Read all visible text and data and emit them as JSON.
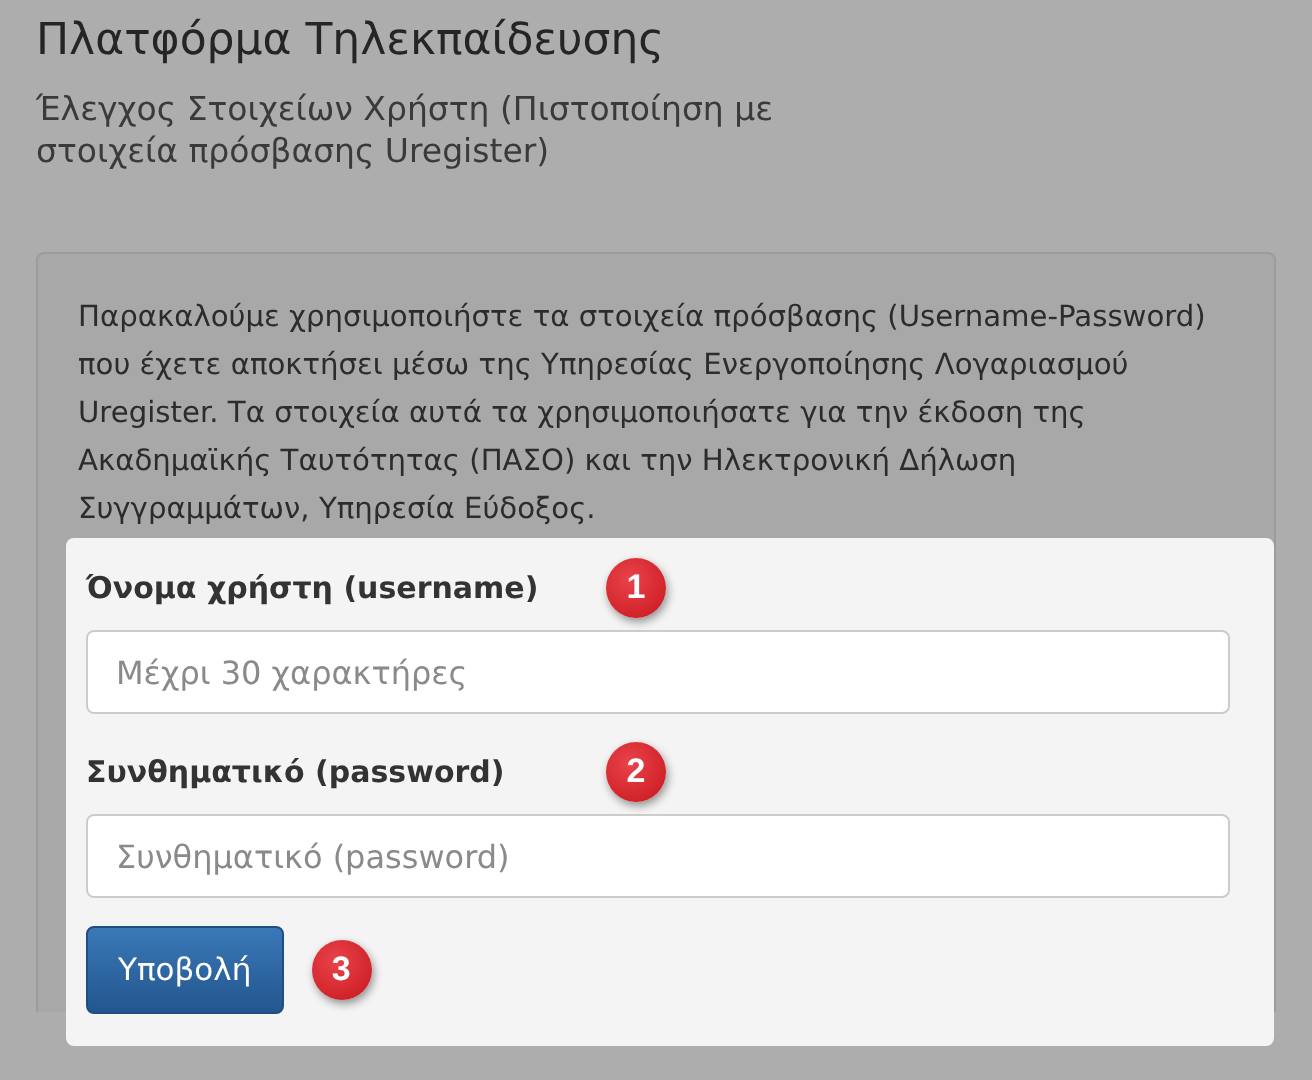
{
  "header": {
    "title": "Πλατφόρμα Τηλεκπαίδευσης",
    "subtitle": "Έλεγχος Στοιχείων Χρήστη (Πιστοποίηση με στοιχεία πρόσβασης Uregister)"
  },
  "panel": {
    "intro": "Παρακαλούμε χρησιμοποιήστε τα στοιχεία πρόσβασης (Username-Password) που έχετε αποκτήσει μέσω της Υπηρεσίας Ενεργοποίησης Λογαριασμού Uregister. Τα στοιχεία αυτά τα χρησιμοποιήσατε για την έκδοση της Ακαδημαϊκής Ταυτότητας (ΠΑΣΟ) και την Ηλεκτρονική Δήλωση Συγγραμμάτων, Υπηρεσία Εύδοξος.",
    "fields": [
      {
        "label": "Όνομα χρήστη (username)",
        "placeholder": "Μέχρι 30 χαρακτήρες",
        "badge": "1"
      },
      {
        "label": "Συνθηματικό (password)",
        "placeholder": "Συνθηματικό (password)",
        "badge": "2"
      }
    ],
    "submit": {
      "label": "Υποβολή",
      "badge": "3"
    }
  }
}
